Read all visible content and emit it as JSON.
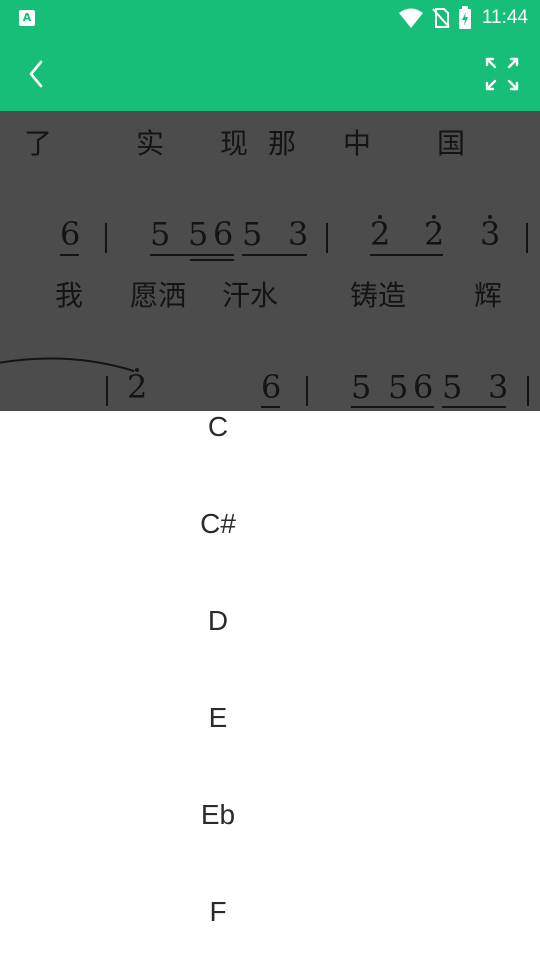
{
  "status_bar": {
    "app_icon_letter": "A",
    "time": "11:44"
  },
  "toolbar": {
    "back_icon": "chevron-left-icon",
    "fullscreen_icon": "expand-icon"
  },
  "colors": {
    "accent": "#16be77",
    "overlay": "#4c4c4c",
    "notation": "#141414",
    "list_text": "#2b2b2b"
  },
  "score": {
    "line1_lyrics": [
      "了",
      "实",
      "现",
      "那",
      "中",
      "国"
    ],
    "line2_notes": [
      "6",
      "5",
      "5",
      "6",
      "5",
      "3",
      "2",
      "2",
      "3"
    ],
    "line2_lyrics": [
      "我",
      "愿洒",
      "汗水",
      "铸造",
      "辉"
    ],
    "line3_notes": [
      "2",
      "6",
      "5",
      "5",
      "6",
      "5",
      "3"
    ]
  },
  "key_list": {
    "items": [
      "C",
      "C#",
      "D",
      "E",
      "Eb",
      "F"
    ]
  }
}
